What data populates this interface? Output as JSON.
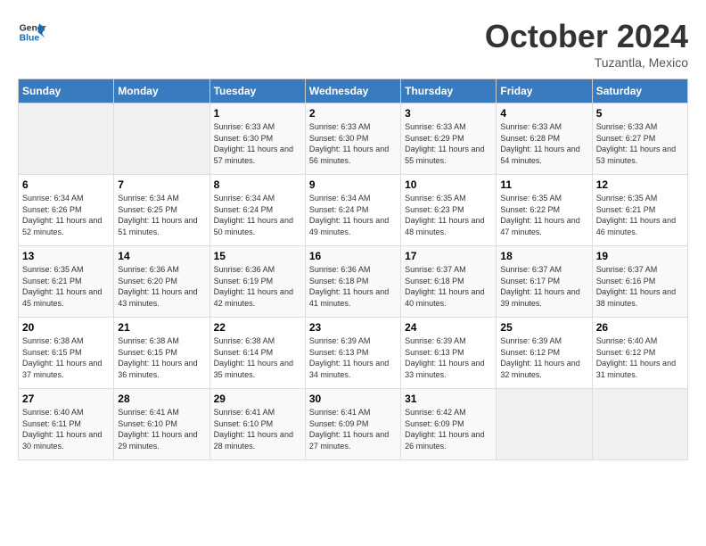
{
  "header": {
    "logo_general": "General",
    "logo_blue": "Blue",
    "month_title": "October 2024",
    "location": "Tuzantla, Mexico"
  },
  "days_of_week": [
    "Sunday",
    "Monday",
    "Tuesday",
    "Wednesday",
    "Thursday",
    "Friday",
    "Saturday"
  ],
  "weeks": [
    [
      {
        "day": "",
        "info": ""
      },
      {
        "day": "",
        "info": ""
      },
      {
        "day": "1",
        "info": "Sunrise: 6:33 AM\nSunset: 6:30 PM\nDaylight: 11 hours and 57 minutes."
      },
      {
        "day": "2",
        "info": "Sunrise: 6:33 AM\nSunset: 6:30 PM\nDaylight: 11 hours and 56 minutes."
      },
      {
        "day": "3",
        "info": "Sunrise: 6:33 AM\nSunset: 6:29 PM\nDaylight: 11 hours and 55 minutes."
      },
      {
        "day": "4",
        "info": "Sunrise: 6:33 AM\nSunset: 6:28 PM\nDaylight: 11 hours and 54 minutes."
      },
      {
        "day": "5",
        "info": "Sunrise: 6:33 AM\nSunset: 6:27 PM\nDaylight: 11 hours and 53 minutes."
      }
    ],
    [
      {
        "day": "6",
        "info": "Sunrise: 6:34 AM\nSunset: 6:26 PM\nDaylight: 11 hours and 52 minutes."
      },
      {
        "day": "7",
        "info": "Sunrise: 6:34 AM\nSunset: 6:25 PM\nDaylight: 11 hours and 51 minutes."
      },
      {
        "day": "8",
        "info": "Sunrise: 6:34 AM\nSunset: 6:24 PM\nDaylight: 11 hours and 50 minutes."
      },
      {
        "day": "9",
        "info": "Sunrise: 6:34 AM\nSunset: 6:24 PM\nDaylight: 11 hours and 49 minutes."
      },
      {
        "day": "10",
        "info": "Sunrise: 6:35 AM\nSunset: 6:23 PM\nDaylight: 11 hours and 48 minutes."
      },
      {
        "day": "11",
        "info": "Sunrise: 6:35 AM\nSunset: 6:22 PM\nDaylight: 11 hours and 47 minutes."
      },
      {
        "day": "12",
        "info": "Sunrise: 6:35 AM\nSunset: 6:21 PM\nDaylight: 11 hours and 46 minutes."
      }
    ],
    [
      {
        "day": "13",
        "info": "Sunrise: 6:35 AM\nSunset: 6:21 PM\nDaylight: 11 hours and 45 minutes."
      },
      {
        "day": "14",
        "info": "Sunrise: 6:36 AM\nSunset: 6:20 PM\nDaylight: 11 hours and 43 minutes."
      },
      {
        "day": "15",
        "info": "Sunrise: 6:36 AM\nSunset: 6:19 PM\nDaylight: 11 hours and 42 minutes."
      },
      {
        "day": "16",
        "info": "Sunrise: 6:36 AM\nSunset: 6:18 PM\nDaylight: 11 hours and 41 minutes."
      },
      {
        "day": "17",
        "info": "Sunrise: 6:37 AM\nSunset: 6:18 PM\nDaylight: 11 hours and 40 minutes."
      },
      {
        "day": "18",
        "info": "Sunrise: 6:37 AM\nSunset: 6:17 PM\nDaylight: 11 hours and 39 minutes."
      },
      {
        "day": "19",
        "info": "Sunrise: 6:37 AM\nSunset: 6:16 PM\nDaylight: 11 hours and 38 minutes."
      }
    ],
    [
      {
        "day": "20",
        "info": "Sunrise: 6:38 AM\nSunset: 6:15 PM\nDaylight: 11 hours and 37 minutes."
      },
      {
        "day": "21",
        "info": "Sunrise: 6:38 AM\nSunset: 6:15 PM\nDaylight: 11 hours and 36 minutes."
      },
      {
        "day": "22",
        "info": "Sunrise: 6:38 AM\nSunset: 6:14 PM\nDaylight: 11 hours and 35 minutes."
      },
      {
        "day": "23",
        "info": "Sunrise: 6:39 AM\nSunset: 6:13 PM\nDaylight: 11 hours and 34 minutes."
      },
      {
        "day": "24",
        "info": "Sunrise: 6:39 AM\nSunset: 6:13 PM\nDaylight: 11 hours and 33 minutes."
      },
      {
        "day": "25",
        "info": "Sunrise: 6:39 AM\nSunset: 6:12 PM\nDaylight: 11 hours and 32 minutes."
      },
      {
        "day": "26",
        "info": "Sunrise: 6:40 AM\nSunset: 6:12 PM\nDaylight: 11 hours and 31 minutes."
      }
    ],
    [
      {
        "day": "27",
        "info": "Sunrise: 6:40 AM\nSunset: 6:11 PM\nDaylight: 11 hours and 30 minutes."
      },
      {
        "day": "28",
        "info": "Sunrise: 6:41 AM\nSunset: 6:10 PM\nDaylight: 11 hours and 29 minutes."
      },
      {
        "day": "29",
        "info": "Sunrise: 6:41 AM\nSunset: 6:10 PM\nDaylight: 11 hours and 28 minutes."
      },
      {
        "day": "30",
        "info": "Sunrise: 6:41 AM\nSunset: 6:09 PM\nDaylight: 11 hours and 27 minutes."
      },
      {
        "day": "31",
        "info": "Sunrise: 6:42 AM\nSunset: 6:09 PM\nDaylight: 11 hours and 26 minutes."
      },
      {
        "day": "",
        "info": ""
      },
      {
        "day": "",
        "info": ""
      }
    ]
  ]
}
